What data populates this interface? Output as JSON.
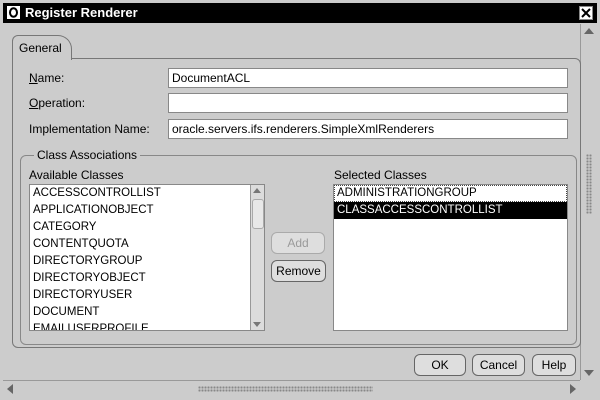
{
  "window": {
    "title": "Register Renderer"
  },
  "tabs": [
    {
      "label": "General"
    }
  ],
  "form": {
    "name": {
      "label_u": "N",
      "label_rest": "ame:",
      "value": "DocumentACL"
    },
    "operation": {
      "label_u": "O",
      "label_rest": "peration:",
      "value": ""
    },
    "implementation": {
      "label": "Implementation Name:",
      "value": "oracle.servers.ifs.renderers.SimpleXmlRenderers"
    }
  },
  "class_associations": {
    "title": "Class Associations",
    "available_label": "Available Classes",
    "selected_label": "Selected Classes",
    "available": [
      "ACCESSCONTROLLIST",
      "APPLICATIONOBJECT",
      "CATEGORY",
      "CONTENTQUOTA",
      "DIRECTORYGROUP",
      "DIRECTORYOBJECT",
      "DIRECTORYUSER",
      "DOCUMENT",
      "EMAILUSERPROFILE"
    ],
    "selected": [
      "ADMINISTRATIONGROUP",
      "CLASSACCESSCONTROLLIST"
    ],
    "add_label": "Add",
    "remove_label": "Remove"
  },
  "footer": {
    "ok_label": "OK",
    "cancel_label": "Cancel",
    "help_label": "Help"
  },
  "icons": {
    "app": "oracle-icon",
    "close": "close-icon"
  },
  "colors": {
    "background": "#cccccc",
    "selection": "#000000",
    "titlebar": "#000000"
  }
}
